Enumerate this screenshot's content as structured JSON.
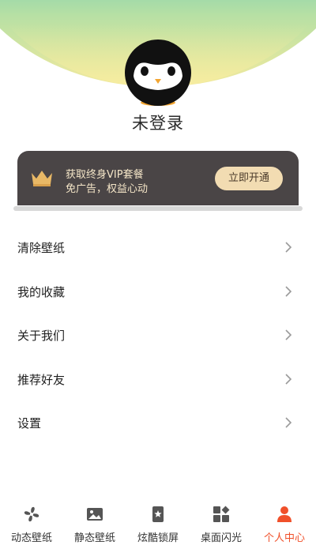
{
  "profile": {
    "username": "未登录"
  },
  "vip": {
    "title": "获取终身VIP套餐",
    "subtitle": "免广告，权益心动",
    "button_label": "立即开通"
  },
  "menu": {
    "items": [
      {
        "label": "清除壁纸"
      },
      {
        "label": "我的收藏"
      },
      {
        "label": "关于我们"
      },
      {
        "label": "推荐好友"
      },
      {
        "label": "设置"
      }
    ]
  },
  "tabbar": {
    "items": [
      {
        "label": "动态壁纸",
        "icon": "fan-icon"
      },
      {
        "label": "静态壁纸",
        "icon": "image-icon"
      },
      {
        "label": "炫酷锁屏",
        "icon": "lock-screen-icon"
      },
      {
        "label": "桌面闪光",
        "icon": "widgets-icon"
      },
      {
        "label": "个人中心",
        "icon": "person-icon"
      }
    ],
    "active_index": 4,
    "active_color": "#f0502a",
    "inactive_color": "#333333"
  },
  "colors": {
    "header_top": "#5ec7b8",
    "header_bottom": "#f3ea9e",
    "vip_card": "#4a4546",
    "vip_button": "#f2dcb2"
  }
}
